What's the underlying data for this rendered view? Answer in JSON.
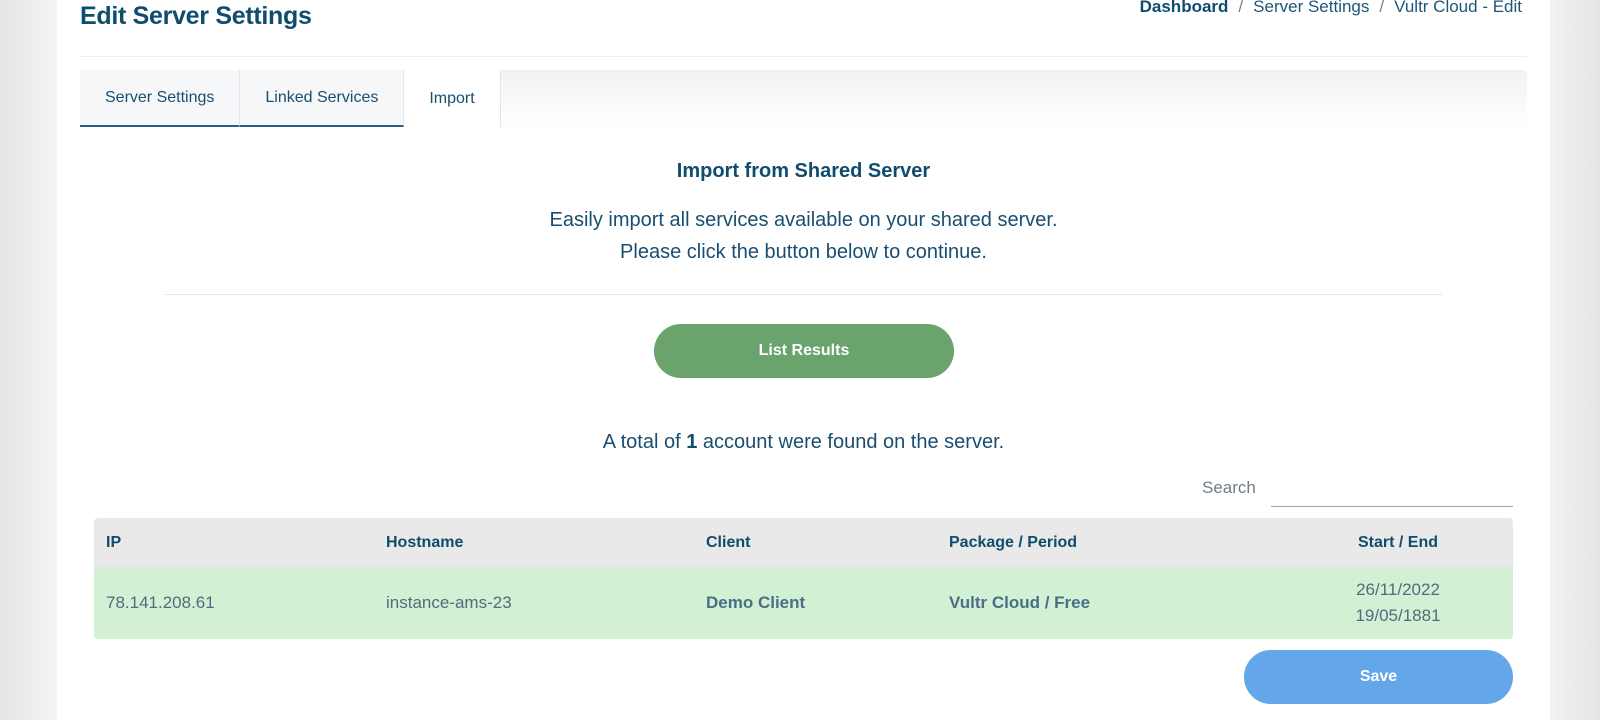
{
  "header": {
    "title": "Edit Server Settings",
    "breadcrumb": [
      "Dashboard",
      "Server Settings",
      "Vultr Cloud - Edit"
    ],
    "breadcrumb_separator": "/"
  },
  "tabs": [
    {
      "label": "Server Settings"
    },
    {
      "label": "Linked Services"
    },
    {
      "label": "Import"
    }
  ],
  "import_section": {
    "title": "Import from Shared Server",
    "line1": "Easily import all services available on your shared server.",
    "line2": "Please click the button below to continue.",
    "list_button": "List Results",
    "total_prefix": "A total of",
    "total_count": "1",
    "total_suffix": "account were found on the server."
  },
  "search": {
    "label": "Search",
    "value": ""
  },
  "table": {
    "columns": [
      "IP",
      "Hostname",
      "Client",
      "Package / Period",
      "Start / End"
    ],
    "rows": [
      {
        "ip": "78.141.208.61",
        "hostname": "instance-ams-23",
        "client": "Demo Client",
        "package": "Vultr Cloud / Free",
        "start": "26/11/2022",
        "end": "19/05/1881"
      }
    ]
  },
  "actions": {
    "save": "Save"
  },
  "colors": {
    "primary_text": "#0f4c6e",
    "list_button": "#6aa36c",
    "save_button": "#63a6ea",
    "row_highlight": "#d2f0d3"
  }
}
